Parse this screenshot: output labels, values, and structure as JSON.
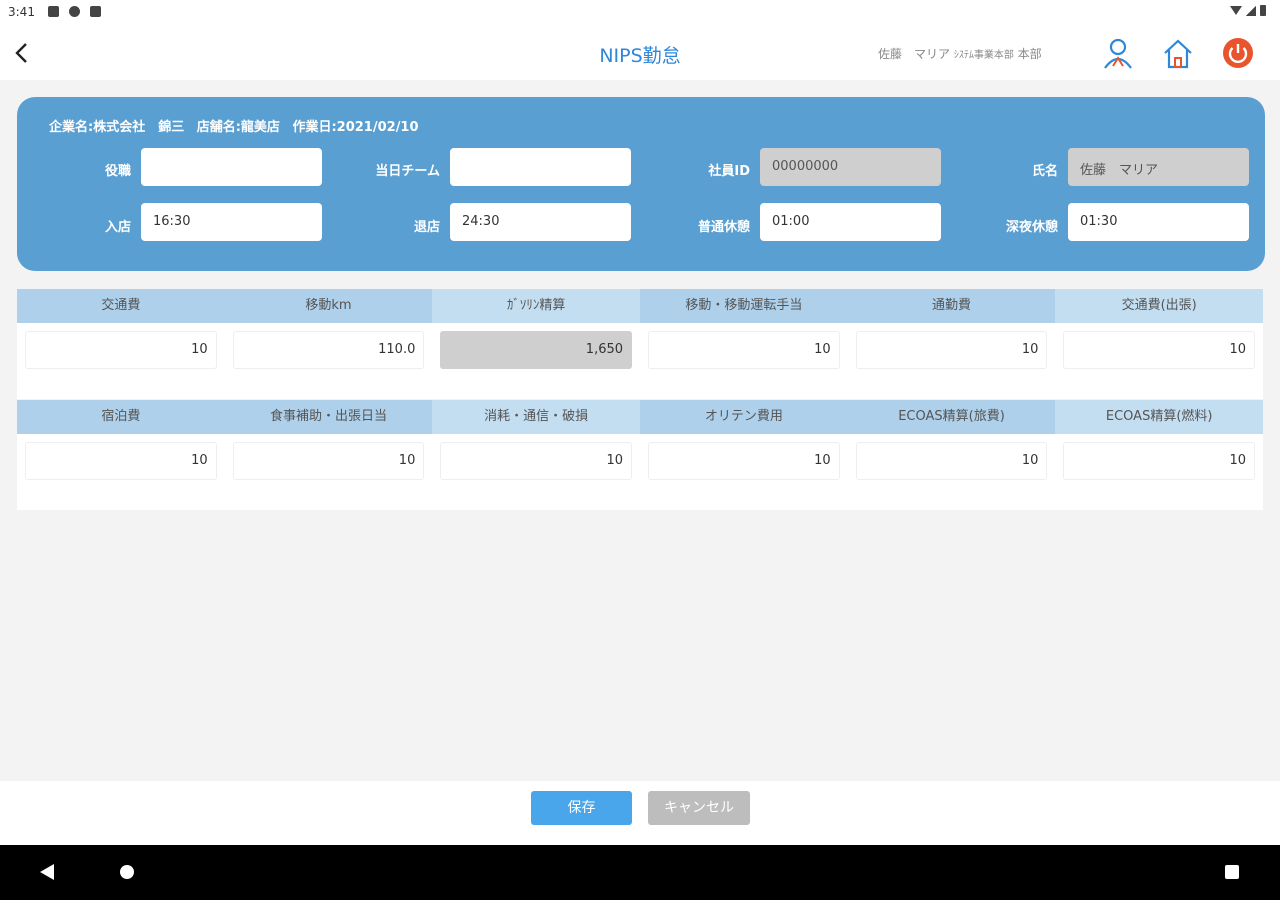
{
  "status_bar": {
    "time": "3:41"
  },
  "header": {
    "title": "NIPS勤怠",
    "user_name": "佐藤　マリア",
    "user_dept": "ｼｽﾃﾑ事業本部",
    "user_unit": "本部",
    "icons": [
      "back-icon",
      "user-icon",
      "home-icon",
      "power-icon"
    ]
  },
  "info": {
    "company": "企業名:株式会社　錦三",
    "store": "店舗名:龍美店",
    "work_date": "作業日:2021/02/10",
    "fields": {
      "role": {
        "label": "役職",
        "value": ""
      },
      "team": {
        "label": "当日チーム",
        "value": ""
      },
      "employee_id": {
        "label": "社員ID",
        "value": "00000000"
      },
      "name": {
        "label": "氏名",
        "value": "佐藤　マリア"
      },
      "check_in": {
        "label": "入店",
        "value": "16:30"
      },
      "check_out": {
        "label": "退店",
        "value": "24:30"
      },
      "normal_break": {
        "label": "普通休憩",
        "value": "01:00"
      },
      "night_break": {
        "label": "深夜休憩",
        "value": "01:30"
      }
    }
  },
  "expenses_row1": {
    "headers": [
      "交通費",
      "移動km",
      "ｶﾞｿﾘﾝ精算",
      "移動・移動運転手当",
      "通勤費",
      "交通費(出張)"
    ],
    "values": [
      "10",
      "110.0",
      "1,650",
      "10",
      "10",
      "10"
    ]
  },
  "expenses_row2": {
    "headers": [
      "宿泊費",
      "食事補助・出張日当",
      "消耗・通信・破損",
      "オリテン費用",
      "ECOAS精算(旅費)",
      "ECOAS精算(燃料)"
    ],
    "values": [
      "10",
      "10",
      "10",
      "10",
      "10",
      "10"
    ]
  },
  "footer": {
    "save_label": "保存",
    "cancel_label": "キャンセル"
  },
  "colors": {
    "accent": "#2f87d9",
    "card": "#5a9fd2",
    "power": "#e8542c",
    "save": "#4aa6ea"
  }
}
